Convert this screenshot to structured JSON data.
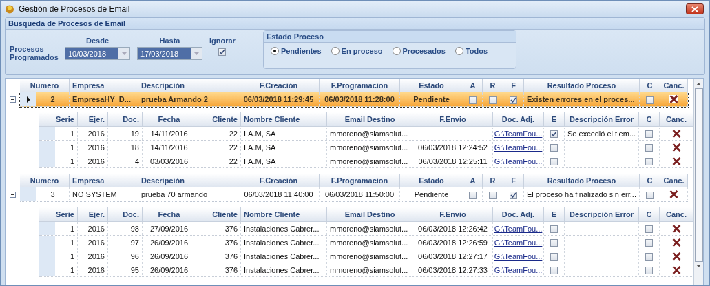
{
  "window": {
    "title": "Gestión de Procesos de Email"
  },
  "search": {
    "title": "Busqueda de Procesos de Email",
    "label": "Procesos Programados",
    "desde": {
      "label": "Desde",
      "value": "10/03/2018"
    },
    "hasta": {
      "label": "Hasta",
      "value": "17/03/2018"
    },
    "ignorar": {
      "label": "Ignorar",
      "checked": true
    },
    "estado": {
      "title": "Estado Proceso",
      "options": [
        {
          "label": "Pendientes",
          "selected": true
        },
        {
          "label": "En proceso",
          "selected": false
        },
        {
          "label": "Procesados",
          "selected": false
        },
        {
          "label": "Todos",
          "selected": false
        }
      ]
    }
  },
  "grid": {
    "records": [
      {
        "selected": true,
        "expanded": true,
        "columns": [
          "Numero",
          "Empresa",
          "Descripción",
          "F.Creación",
          "F.Programacion",
          "Estado",
          "A",
          "R",
          "F",
          "Resultado Proceso",
          "C",
          "Canc."
        ],
        "numero": "2",
        "empresa": "EmpresaHY_D...",
        "descripcion": "prueba Armando 2",
        "f_creacion": "06/03/2018 11:29:45",
        "f_programacion": "06/03/2018 11:28:00",
        "estado": "Pendiente",
        "a": false,
        "r": false,
        "f": true,
        "resultado": "Existen errores en el proces...",
        "c": false,
        "detail": {
          "columns": [
            "Serie",
            "Ejer.",
            "Doc.",
            "Fecha",
            "Cliente",
            "Nombre Cliente",
            "Email Destino",
            "F.Envio",
            "Doc. Adj.",
            "E",
            "Descripción Error",
            "C",
            "Canc."
          ],
          "rows": [
            {
              "serie": "1",
              "ejer": "2016",
              "doc": "19",
              "fecha": "14/11/2016",
              "cliente": "22",
              "nombre_cliente": "I.A.M, SA",
              "email": "mmoreno@siamsolut...",
              "doc_adj": "G:\\TeamFou...",
              "e": true,
              "descripcion_error": "Se excedió el tiem...",
              "c": false
            },
            {
              "serie": "1",
              "ejer": "2016",
              "doc": "18",
              "fecha": "14/11/2016",
              "cliente": "22",
              "nombre_cliente": "I.A.M, SA",
              "email": "mmoreno@siamsolut...",
              "f_envio": "06/03/2018 12:24:52",
              "doc_adj": "G:\\TeamFou...",
              "e": false,
              "c": false
            },
            {
              "serie": "1",
              "ejer": "2016",
              "doc": "4",
              "fecha": "03/03/2016",
              "cliente": "22",
              "nombre_cliente": "I.A.M, SA",
              "email": "mmoreno@siamsolut...",
              "f_envio": "06/03/2018 12:25:11",
              "doc_adj": "G:\\TeamFou...",
              "e": false,
              "c": false
            }
          ]
        }
      },
      {
        "selected": false,
        "expanded": true,
        "columns": [
          "Numero",
          "Empresa",
          "Descripción",
          "F.Creación",
          "F.Programacion",
          "Estado",
          "A",
          "R",
          "F",
          "Resultado Proceso",
          "C",
          "Canc."
        ],
        "numero": "3",
        "empresa": "NO SYSTEM",
        "descripcion": "prueba 70 armando",
        "f_creacion": "06/03/2018 11:40:00",
        "f_programacion": "06/03/2018 11:50:00",
        "estado": "Pendiente",
        "a": false,
        "r": false,
        "f": true,
        "resultado": "El proceso ha finalizado sin err...",
        "c": false,
        "detail": {
          "columns": [
            "Serie",
            "Ejer.",
            "Doc.",
            "Fecha",
            "Cliente",
            "Nombre Cliente",
            "Email Destino",
            "F.Envio",
            "Doc. Adj.",
            "E",
            "Descripción Error",
            "C",
            "Canc."
          ],
          "rows": [
            {
              "serie": "1",
              "ejer": "2016",
              "doc": "98",
              "fecha": "27/09/2016",
              "cliente": "376",
              "nombre_cliente": "Instalaciones Cabrer...",
              "email": "mmoreno@siamsolut...",
              "f_envio": "06/03/2018 12:26:42",
              "doc_adj": "G:\\TeamFou...",
              "e": false,
              "c": false
            },
            {
              "serie": "1",
              "ejer": "2016",
              "doc": "97",
              "fecha": "26/09/2016",
              "cliente": "376",
              "nombre_cliente": "Instalaciones Cabrer...",
              "email": "mmoreno@siamsolut...",
              "f_envio": "06/03/2018 12:26:59",
              "doc_adj": "G:\\TeamFou...",
              "e": false,
              "c": false
            },
            {
              "serie": "1",
              "ejer": "2016",
              "doc": "96",
              "fecha": "26/09/2016",
              "cliente": "376",
              "nombre_cliente": "Instalaciones Cabrer...",
              "email": "mmoreno@siamsolut...",
              "f_envio": "06/03/2018 12:27:17",
              "doc_adj": "G:\\TeamFou...",
              "e": false,
              "c": false
            },
            {
              "serie": "1",
              "ejer": "2016",
              "doc": "95",
              "fecha": "26/09/2016",
              "cliente": "376",
              "nombre_cliente": "Instalaciones Cabrer...",
              "email": "mmoreno@siamsolut...",
              "f_envio": "06/03/2018 12:27:33",
              "doc_adj": "G:\\TeamFou...",
              "e": false,
              "c": false
            }
          ]
        }
      }
    ]
  }
}
